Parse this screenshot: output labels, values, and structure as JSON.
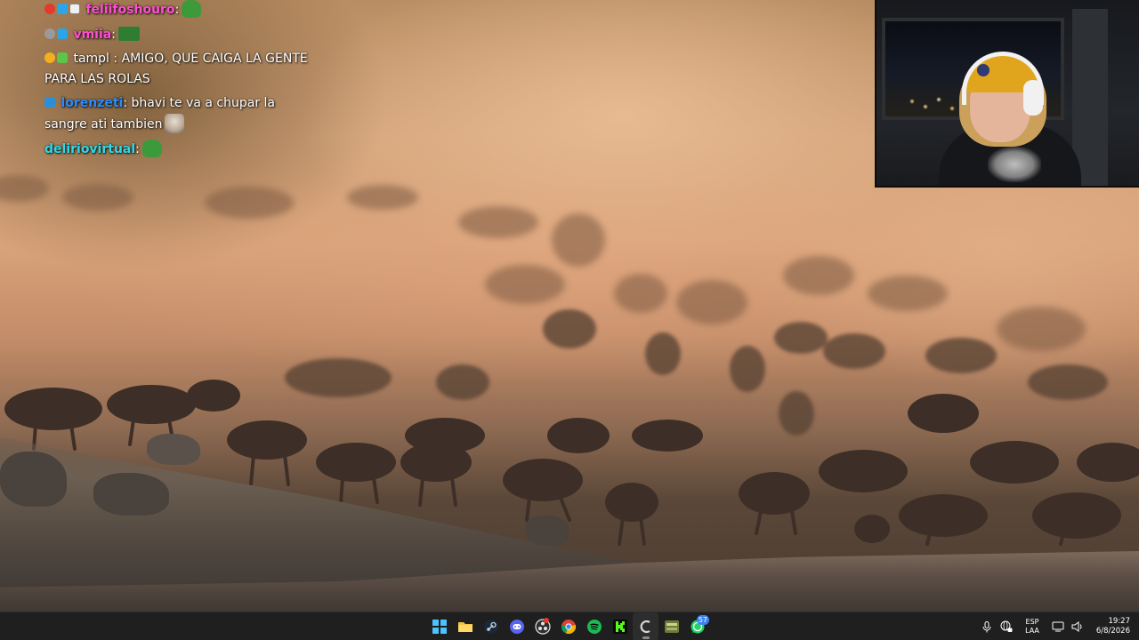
{
  "chat": {
    "messages": [
      {
        "user": "feliifoshouro",
        "user_color": "#ff4fd2",
        "text": ""
      },
      {
        "user": "vmiia",
        "user_color": "#ff4fd2",
        "text": ""
      },
      {
        "user": "tampl",
        "user_color": "#ffffff",
        "text": "AMIGO, QUE CAIGA LA GENTE PARA LAS ROLAS"
      },
      {
        "user": "lorenzeti",
        "user_color": "#2b8cff",
        "text": "bhavi te va a chupar la sangre ati tambien"
      },
      {
        "user": "deliriovirtual",
        "user_color": "#2fd7e6",
        "text": ""
      }
    ]
  },
  "webcam": {
    "label": "Streamer webcam"
  },
  "taskbar": {
    "apps": [
      {
        "name": "start",
        "icon": "windows-icon"
      },
      {
        "name": "file-explorer",
        "icon": "folder-icon"
      },
      {
        "name": "steam",
        "icon": "steam-icon"
      },
      {
        "name": "discord",
        "icon": "discord-icon"
      },
      {
        "name": "obs",
        "icon": "obs-icon"
      },
      {
        "name": "chrome",
        "icon": "chrome-icon"
      },
      {
        "name": "spotify",
        "icon": "spotify-icon"
      },
      {
        "name": "kick",
        "icon": "kick-icon"
      },
      {
        "name": "cursor",
        "icon": "cursor-icon"
      },
      {
        "name": "game",
        "icon": "game-icon"
      },
      {
        "name": "whatsapp",
        "icon": "whatsapp-icon",
        "badge": "57"
      }
    ],
    "tray": {
      "lang_top": "ESP",
      "lang_bottom": "LAA",
      "time": "19:27",
      "date": "6/8/2026"
    }
  },
  "colors": {
    "taskbar_bg": "#1f1f1f",
    "accent_blue": "#4cc2ff",
    "spotify_green": "#1db954",
    "kick_green": "#53fc18"
  }
}
